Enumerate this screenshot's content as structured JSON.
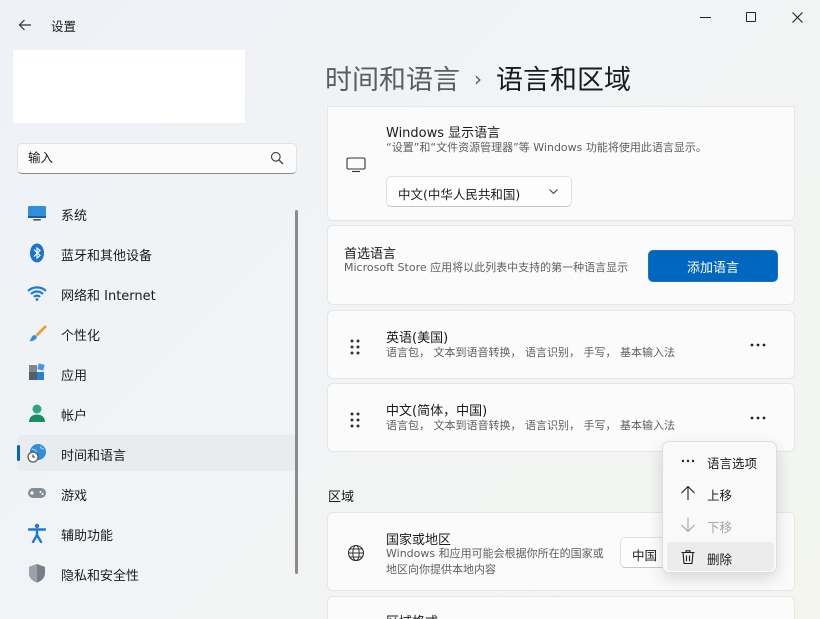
{
  "app": {
    "title": "设置"
  },
  "search": {
    "placeholder": "输入"
  },
  "sidebar": {
    "items": [
      {
        "label": "系统",
        "icon": "monitor-icon"
      },
      {
        "label": "蓝牙和其他设备",
        "icon": "bluetooth-icon"
      },
      {
        "label": "网络和 Internet",
        "icon": "wifi-icon"
      },
      {
        "label": "个性化",
        "icon": "brush-icon"
      },
      {
        "label": "应用",
        "icon": "apps-icon"
      },
      {
        "label": "帐户",
        "icon": "account-icon"
      },
      {
        "label": "时间和语言",
        "icon": "globe-clock-icon",
        "active": true
      },
      {
        "label": "游戏",
        "icon": "gamepad-icon"
      },
      {
        "label": "辅助功能",
        "icon": "accessibility-icon"
      },
      {
        "label": "隐私和安全性",
        "icon": "shield-icon"
      }
    ]
  },
  "breadcrumb": {
    "parent": "时间和语言",
    "separator": "›",
    "current": "语言和区域"
  },
  "display_language": {
    "title": "Windows 显示语言",
    "description": "“设置”和“文件资源管理器”等 Windows 功能将使用此语言显示。",
    "selected": "中文(中华人民共和国)",
    "icon": "monitor-outline-icon"
  },
  "preferred": {
    "title": "首选语言",
    "description": "Microsoft Store 应用将以此列表中支持的第一种语言显示",
    "button": "添加语言"
  },
  "languages": [
    {
      "name": "英语(美国)",
      "features": "语言包， 文本到语音转换， 语言识别， 手写， 基本输入法"
    },
    {
      "name": "中文(简体，中国)",
      "features": "语言包， 文本到语音转换， 语言识别， 手写， 基本输入法"
    }
  ],
  "region": {
    "section_title": "区域",
    "country": {
      "title": "国家或地区",
      "description": "Windows 和应用可能会根据你所在的国家或地区向你提供本地内容",
      "value": "中国",
      "icon": "globe-icon"
    },
    "format_title_partial": "区域格式"
  },
  "context_menu": {
    "items": [
      {
        "label": "语言选项",
        "icon": "more-horizontal-icon",
        "disabled": false
      },
      {
        "label": "上移",
        "icon": "arrow-up-icon",
        "disabled": false
      },
      {
        "label": "下移",
        "icon": "arrow-down-icon",
        "disabled": true
      },
      {
        "label": "删除",
        "icon": "trash-icon",
        "disabled": false
      }
    ]
  },
  "colors": {
    "accent": "#0067c0"
  }
}
